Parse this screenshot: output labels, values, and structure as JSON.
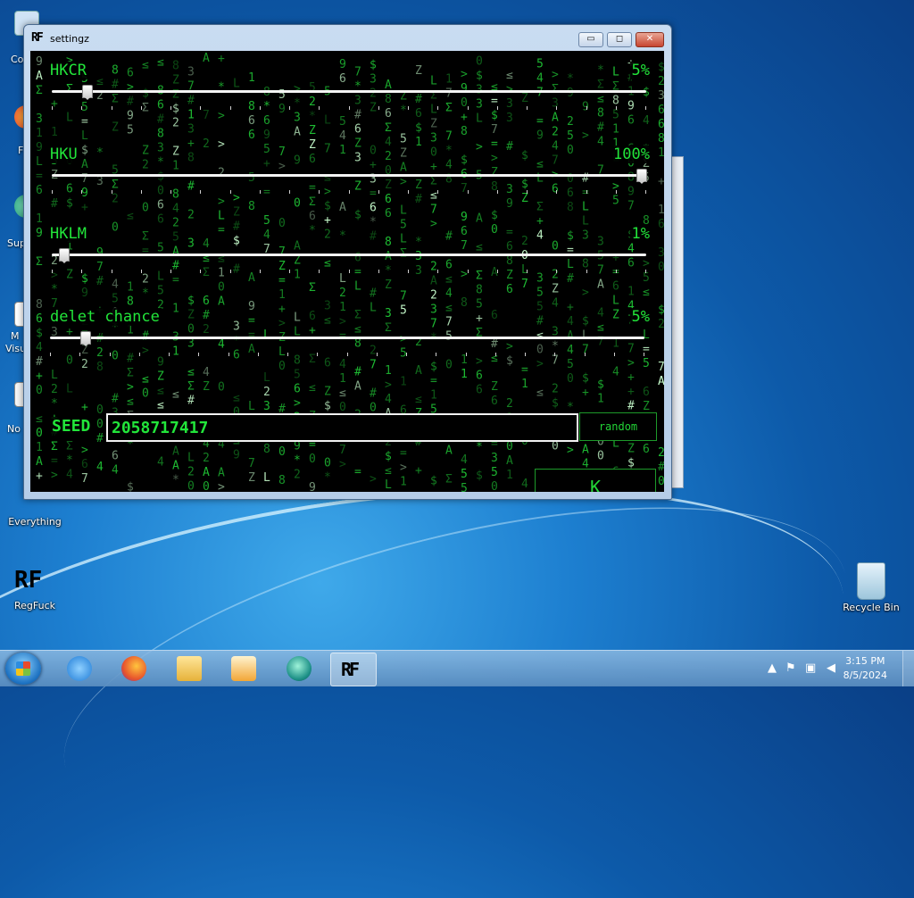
{
  "desktop": {
    "icons": [
      {
        "label": "Everything"
      },
      {
        "label": "RegFuck"
      },
      {
        "label": "Recycle Bin"
      }
    ],
    "edge_labels": [
      "Co",
      "F",
      "Sup",
      "M",
      "Visu",
      "No"
    ]
  },
  "window": {
    "logo": "RF",
    "title": "settingz",
    "minimize_glyph": "▭",
    "maximize_glyph": "◻",
    "close_glyph": "✕"
  },
  "settings": {
    "rows": [
      {
        "label": "HKCR",
        "value_text": "5%",
        "value": 5
      },
      {
        "label": "HKU",
        "value_text": "100%",
        "value": 100
      },
      {
        "label": "HKLM",
        "value_text": "1%",
        "value": 1
      },
      {
        "label": "delet chance",
        "value_text": "5%",
        "value": 5
      }
    ],
    "seed_label": "SEED",
    "seed_value": "2058717417",
    "random_button": "random",
    "ok_button": "K"
  },
  "taskbar": {
    "clock_time": "3:15 PM",
    "clock_date": "8/5/2024",
    "pinned": [
      "windows-explorer-ie",
      "firefox",
      "file-explorer",
      "media-player",
      "edge-like",
      "regfuck"
    ],
    "active_logo": "RF"
  },
  "colors": {
    "matrix_green": "#22e53a",
    "window_chrome": "#c9dcf1"
  }
}
